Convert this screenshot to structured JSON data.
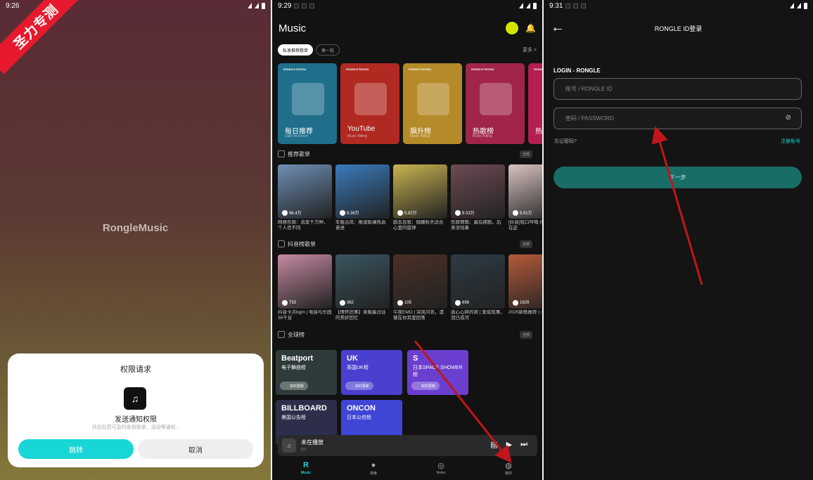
{
  "watermark": "圣力专测",
  "panel1": {
    "status_time": "9:26",
    "app_name": "RongleMusic",
    "dialog": {
      "title": "权限请求",
      "permission": "发送通知权限",
      "description": "开启后您可及时收到歌单、活动等通知...",
      "confirm_label": "跳转",
      "cancel_label": "取消"
    }
  },
  "panel2": {
    "status_time": "9:29",
    "title": "Music",
    "chips": [
      "私享推荐歌单",
      "换一批"
    ],
    "more_label": "更多 >",
    "features": [
      {
        "brand": "RONGLE ROSSA",
        "name": "每日推荐",
        "sub": "Daily Recomm",
        "color": "#1f6f8b"
      },
      {
        "brand": "RONGLE ROSSA",
        "name": "YouTube",
        "sub": "Music Billing",
        "color": "#b02a22"
      },
      {
        "brand": "RONGLE ROSSA",
        "name": "飙升榜",
        "sub": "Music Billing",
        "color": "#b58a28"
      },
      {
        "brand": "RONGLE ROSSA",
        "name": "热歌榜",
        "sub": "Music Billing",
        "color": "#a02548"
      },
      {
        "brand": "RONGLE ROSSA",
        "name": "热",
        "sub": "",
        "color": "#b21f50"
      }
    ],
    "section1": {
      "title": "推荐歌单",
      "all_label": "全部",
      "items": [
        {
          "count": "96.4万",
          "caption": "网络伤感：逃爱千万种，个人否不同",
          "color": "#6e8fb5"
        },
        {
          "count": "9.36万",
          "caption": "车载古风：推波助澜热血奋进",
          "color": "#3a7bbd"
        },
        {
          "count": "5.82万",
          "caption": "励志自我：微醺秋天适合心里的旋律",
          "color": "#c9b451"
        },
        {
          "count": "8.03万",
          "caption": "伤感情歌：最后拥抱，后来没结果",
          "color": "#6d4b54"
        },
        {
          "count": "9.91万",
          "caption": "[抖音]轻口哼唱 你想要的都在这",
          "color": "#d9c3c0"
        }
      ]
    },
    "section2": {
      "title": "抖音榜歌单",
      "all_label": "全部",
      "items": [
        {
          "count": "733",
          "caption": "抖音卡点bgm | 电音与乐园38千足",
          "color": "#c58aa3"
        },
        {
          "count": "362",
          "caption": "【情怀旧事】承载着过往的美好回忆",
          "color": "#3a5560"
        },
        {
          "count": "105",
          "caption": "午夜EMO | 突风问答，遗憾在你耳里回荡",
          "color": "#4a3026"
        },
        {
          "count": "698",
          "caption": "虐心心碎的夜 | 爱成就事，泪已成河",
          "color": "#2d3b45"
        },
        {
          "count": "1629",
          "caption": "2025新歌推荐 | 小的奇迹",
          "color": "#b65a3a"
        }
      ]
    },
    "section3": {
      "title": "全球榜",
      "all_label": "全部",
      "items": [
        {
          "name": "Beatport",
          "sub": "电子舞曲榜",
          "btn": "实时更新",
          "color": "#2f3a3a"
        },
        {
          "name": "UK",
          "sub": "英国UK榜",
          "btn": "实时更新",
          "color": "#4b3fcf"
        },
        {
          "name": "S",
          "sub": "日本SPACE SHOWER榜",
          "btn": "实时更新",
          "color": "#6a3fd0"
        },
        {
          "name": "BILLBOARD",
          "sub": "美国公告榜",
          "btn": "",
          "color": "#2d2e4a"
        },
        {
          "name": "ONCON",
          "sub": "日本公信榜",
          "btn": "",
          "color": "#3f46d6"
        }
      ]
    },
    "player": {
      "title": "未在播放",
      "time": "0:0"
    },
    "tabs": [
      {
        "icon": "R",
        "label": "Music"
      },
      {
        "icon": "●",
        "label": "搜索"
      },
      {
        "icon": "◎",
        "label": "Notes"
      },
      {
        "icon": "◍",
        "label": "我的"
      }
    ]
  },
  "panel3": {
    "status_time": "9:31",
    "title": "RONGLE ID登录",
    "section_label": "LOGIN - RONGLE",
    "account_placeholder": "账号 / RONGLE ID",
    "password_placeholder": "密码 / PASSWORD",
    "forgot_label": "忘记密码?",
    "register_label": "注册账号",
    "next_label": "下一步"
  },
  "colors": {
    "accent": "#18d6d6",
    "arrow": "#c0161b",
    "ribbon": "#e8192c"
  }
}
